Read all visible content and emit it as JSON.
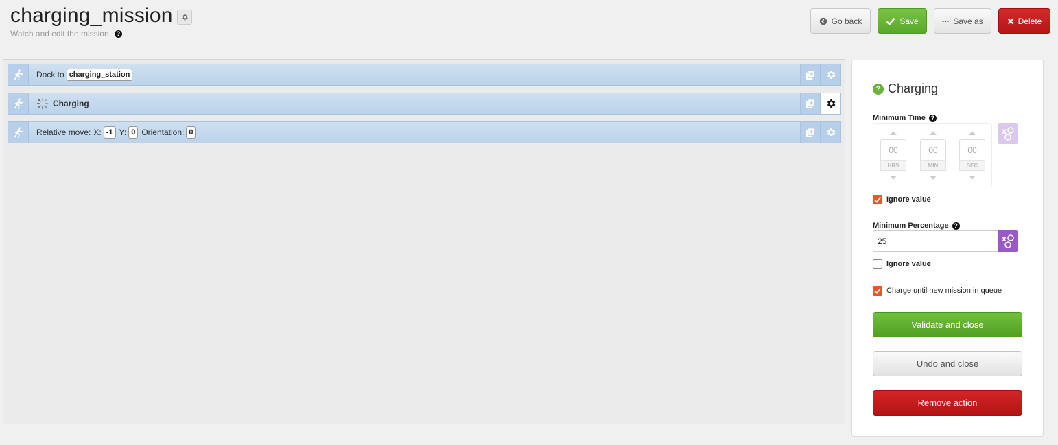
{
  "header": {
    "title": "charging_mission",
    "subtitle": "Watch and edit the mission.",
    "buttons": {
      "go_back": "Go back",
      "save": "Save",
      "save_as": "Save as",
      "delete": "Delete"
    }
  },
  "mission": {
    "actions": [
      {
        "icon": "walking-person-icon",
        "label": "Dock to",
        "param": "charging_station"
      },
      {
        "icon": "walking-person-icon",
        "label": "Charging",
        "status": "loading",
        "active": true
      },
      {
        "icon": "walking-person-icon",
        "label": "Relative move:",
        "x_label": "X:",
        "x": "-1",
        "y_label": "Y:",
        "y": "0",
        "orientation_label": "Orientation:",
        "orientation": "0"
      }
    ]
  },
  "config": {
    "title": "Charging",
    "minimum_time": {
      "label": "Minimum Time",
      "hours": "00",
      "minutes": "00",
      "seconds": "00",
      "units": [
        "HRS",
        "MIN",
        "SEC"
      ],
      "ignore_label": "Ignore value",
      "ignore_checked": true
    },
    "minimum_percentage": {
      "label": "Minimum Percentage",
      "value": "25",
      "ignore_label": "Ignore value",
      "ignore_checked": false
    },
    "charge_until": {
      "label": "Charge until new mission in queue",
      "checked": true
    },
    "buttons": {
      "validate": "Validate and close",
      "undo": "Undo and close",
      "remove": "Remove action"
    }
  },
  "colors": {
    "accent_green": "#5aa82a",
    "danger_red": "#b51616",
    "row_blue": "#bcd3ea",
    "checkbox_orange": "#e8572c",
    "variable_purple": "#9b59c8"
  }
}
